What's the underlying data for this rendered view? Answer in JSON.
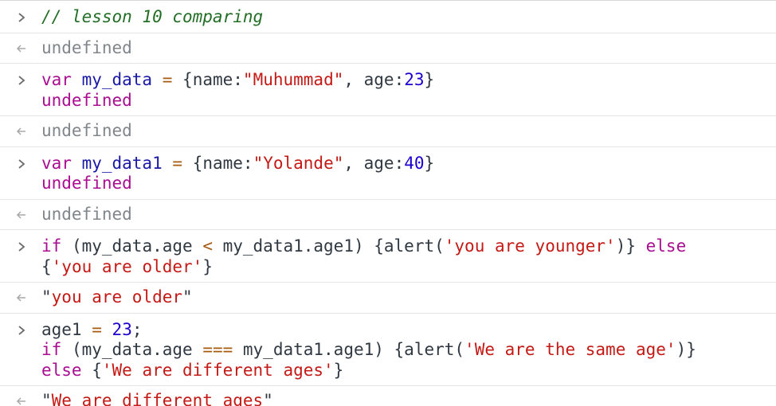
{
  "entries": [
    {
      "type": "input",
      "lines": [
        [
          {
            "t": "// lesson 10 comparing",
            "c": "comment"
          }
        ]
      ]
    },
    {
      "type": "output",
      "lines": [
        [
          {
            "t": "undefined",
            "c": "undef"
          }
        ]
      ]
    },
    {
      "type": "input",
      "lines": [
        [
          {
            "t": "var ",
            "c": "kw"
          },
          {
            "t": "my_data",
            "c": "def"
          },
          {
            "t": " ",
            "c": "plain"
          },
          {
            "t": "=",
            "c": "op"
          },
          {
            "t": " {name:",
            "c": "plain"
          },
          {
            "t": "\"Muhummad\"",
            "c": "str"
          },
          {
            "t": ", age:",
            "c": "plain"
          },
          {
            "t": "23",
            "c": "num"
          },
          {
            "t": "}",
            "c": "plain"
          }
        ],
        [
          {
            "t": "undefined",
            "c": "echo-undef"
          }
        ]
      ]
    },
    {
      "type": "output",
      "lines": [
        [
          {
            "t": "undefined",
            "c": "undef"
          }
        ]
      ]
    },
    {
      "type": "input",
      "lines": [
        [
          {
            "t": "var ",
            "c": "kw"
          },
          {
            "t": "my_data1",
            "c": "def"
          },
          {
            "t": " ",
            "c": "plain"
          },
          {
            "t": "=",
            "c": "op"
          },
          {
            "t": " {name:",
            "c": "plain"
          },
          {
            "t": "\"Yolande\"",
            "c": "str"
          },
          {
            "t": ", age:",
            "c": "plain"
          },
          {
            "t": "40",
            "c": "num"
          },
          {
            "t": "}",
            "c": "plain"
          }
        ],
        [
          {
            "t": "undefined",
            "c": "echo-undef"
          }
        ]
      ]
    },
    {
      "type": "output",
      "lines": [
        [
          {
            "t": "undefined",
            "c": "undef"
          }
        ]
      ]
    },
    {
      "type": "input",
      "lines": [
        [
          {
            "t": "if",
            "c": "kw"
          },
          {
            "t": " (my_data.age ",
            "c": "plain"
          },
          {
            "t": "<",
            "c": "op"
          },
          {
            "t": " my_data1.age1) {alert(",
            "c": "plain"
          },
          {
            "t": "'you are younger'",
            "c": "str"
          },
          {
            "t": ")} ",
            "c": "plain"
          },
          {
            "t": "else",
            "c": "kw"
          }
        ],
        [
          {
            "t": "{",
            "c": "plain"
          },
          {
            "t": "'you are older'",
            "c": "str"
          },
          {
            "t": "}",
            "c": "plain"
          }
        ]
      ]
    },
    {
      "type": "output",
      "lines": [
        [
          {
            "t": "\"",
            "c": "quote"
          },
          {
            "t": "you are older",
            "c": "result-str"
          },
          {
            "t": "\"",
            "c": "quote"
          }
        ]
      ]
    },
    {
      "type": "input",
      "lines": [
        [
          {
            "t": "age1",
            "c": "plain"
          },
          {
            "t": " ",
            "c": "plain"
          },
          {
            "t": "=",
            "c": "op"
          },
          {
            "t": " ",
            "c": "plain"
          },
          {
            "t": "23",
            "c": "num"
          },
          {
            "t": ";",
            "c": "plain"
          }
        ],
        [
          {
            "t": "if",
            "c": "kw"
          },
          {
            "t": " (my_data.age ",
            "c": "plain"
          },
          {
            "t": "===",
            "c": "op"
          },
          {
            "t": " my_data1.age1) {alert(",
            "c": "plain"
          },
          {
            "t": "'We are the same age'",
            "c": "str"
          },
          {
            "t": ")}",
            "c": "plain"
          }
        ],
        [
          {
            "t": "else",
            "c": "kw"
          },
          {
            "t": " {",
            "c": "plain"
          },
          {
            "t": "'We are different ages'",
            "c": "str"
          },
          {
            "t": "}",
            "c": "plain"
          }
        ]
      ]
    },
    {
      "type": "output",
      "lines": [
        [
          {
            "t": "\"",
            "c": "quote"
          },
          {
            "t": "We are different ages",
            "c": "result-str"
          },
          {
            "t": "\"",
            "c": "quote"
          }
        ]
      ]
    }
  ]
}
